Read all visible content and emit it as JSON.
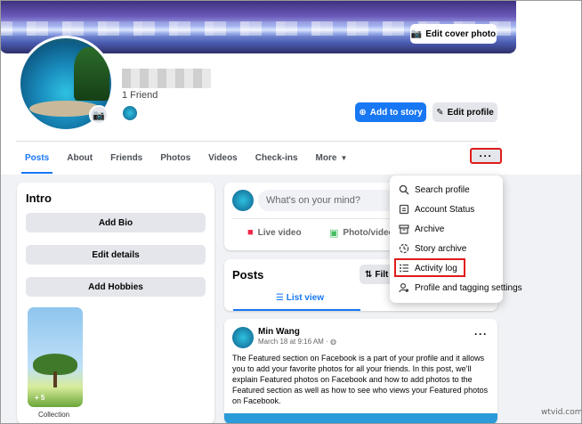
{
  "header": {
    "edit_cover_label": "Edit cover photo",
    "friends_count": "1 Friend",
    "add_story_label": "Add to story",
    "edit_profile_label": "Edit profile"
  },
  "tabs": [
    {
      "label": "Posts",
      "active": true
    },
    {
      "label": "About",
      "active": false
    },
    {
      "label": "Friends",
      "active": false
    },
    {
      "label": "Photos",
      "active": false
    },
    {
      "label": "Videos",
      "active": false
    },
    {
      "label": "Check-ins",
      "active": false
    },
    {
      "label": "More",
      "active": false
    }
  ],
  "more_dots": "···",
  "intro": {
    "title": "Intro",
    "buttons": [
      "Add Bio",
      "Edit details",
      "Add Hobbies"
    ],
    "collection_count": "+ 5",
    "collection_label": "Collection"
  },
  "composer": {
    "placeholder": "What's on your mind?",
    "live_video": "Live video",
    "photo_video": "Photo/video"
  },
  "posts": {
    "title": "Posts",
    "filter_label": "Filt",
    "list_view": "List view"
  },
  "post": {
    "author": "Min Wang",
    "date": "March 18 at 9:16 AM ·",
    "menu": "···",
    "text": "The Featured section on Facebook is a part of your profile and it allows you to add your favorite photos for all your friends. In this post, we'll explain Featured photos on Facebook and how to add photos to the Featured section as well as how to see who views your Featured photos on Facebook."
  },
  "dropdown": {
    "items": [
      {
        "label": "Search profile",
        "icon": "search-icon"
      },
      {
        "label": "Account Status",
        "icon": "account-status-icon"
      },
      {
        "label": "Archive",
        "icon": "archive-icon"
      },
      {
        "label": "Story archive",
        "icon": "story-archive-icon"
      },
      {
        "label": "Activity log",
        "icon": "list-icon"
      },
      {
        "label": "Profile and tagging settings",
        "icon": "tag-settings-icon"
      }
    ],
    "highlighted": "Activity log"
  },
  "colors": {
    "accent": "#1877f2",
    "highlight_border": "#e01b1b",
    "page_bg": "#f0f2f5"
  },
  "watermark": "wtvid.com"
}
